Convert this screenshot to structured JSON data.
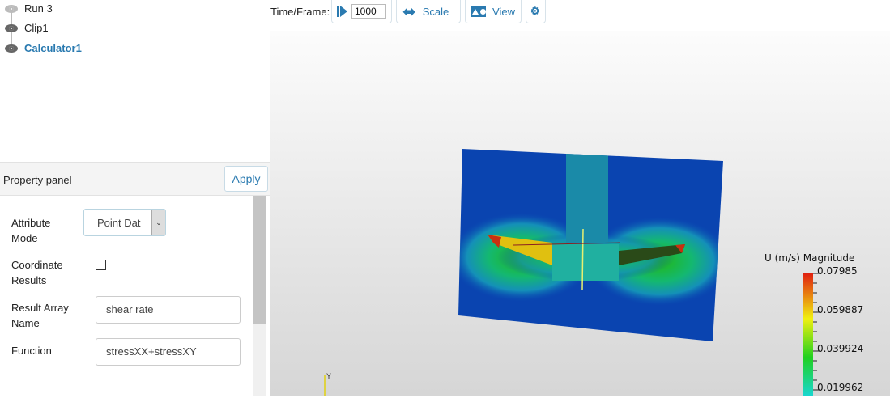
{
  "pipeline": {
    "items": [
      {
        "label": "Run 3",
        "visible": false
      },
      {
        "label": "Clip1",
        "visible": true
      },
      {
        "label": "Calculator1",
        "visible": true,
        "selected": true
      }
    ]
  },
  "property_panel": {
    "title": "Property panel",
    "apply_label": "Apply",
    "attribute_mode_label": "Attribute Mode",
    "attribute_mode_value": "Point Dat",
    "coordinate_results_label": "Coordinate Results",
    "coordinate_results_checked": false,
    "result_array_name_label": "Result Array Name",
    "result_array_name_value": "shear rate",
    "function_label": "Function",
    "function_value": "stressXX+stressXY"
  },
  "toolbar": {
    "time_label": "Time/Frame:",
    "time_value": "1000",
    "scale_label": "Scale",
    "view_label": "View"
  },
  "scalar_bar": {
    "title": "U (m/s) Magnitude",
    "ticks": [
      "0.07985",
      "0.059887",
      "0.039924",
      "0.019962"
    ]
  },
  "axes": {
    "y_label": "Y"
  },
  "colors": {
    "accent": "#2a7ab0"
  }
}
